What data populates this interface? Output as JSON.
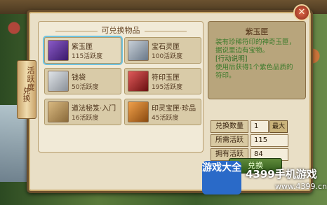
{
  "window": {
    "title": "可兑换物品",
    "close_glyph": "✕"
  },
  "side_tab": {
    "label_a": "活跃度",
    "label_b": "兑换"
  },
  "items": [
    {
      "name": "紫玉匣",
      "cost": "115活跃度",
      "icon": "purple-chest-icon",
      "color": "#5a3a8a"
    },
    {
      "name": "宝石灵匣",
      "cost": "100活跃度",
      "icon": "gem-chest-icon",
      "color": "#8a9aa8"
    },
    {
      "name": "钱袋",
      "cost": "50活跃度",
      "icon": "coin-pouch-icon",
      "color": "#9aa0a8"
    },
    {
      "name": "符印玉匣",
      "cost": "195活跃度",
      "icon": "red-chest-icon",
      "color": "#9a2a2a"
    },
    {
      "name": "道法秘笈·入门",
      "cost": "16活跃度",
      "icon": "scroll-book-icon",
      "color": "#a88a5a"
    },
    {
      "name": "印灵宝匣·珍品",
      "cost": "45活跃度",
      "icon": "orange-chest-icon",
      "color": "#c8782a"
    }
  ],
  "detail": {
    "title": "紫玉匣",
    "description": "装有珍稀符印的神奇玉匣，据说里边有宝物。",
    "tag": "[行动说明]",
    "usage": "使用后获得1个紫色品质的符印。"
  },
  "form": {
    "qty_label": "兑换数量",
    "qty_value": "1",
    "max_label": "最大",
    "need_label": "所需活跃",
    "need_value": "115",
    "have_label": "拥有活跃",
    "have_value": "84"
  },
  "confirm_label": "兑换",
  "watermark": {
    "logo": "游戏大全",
    "text": "4399手机游戏",
    "url": "www.4399.cn"
  }
}
